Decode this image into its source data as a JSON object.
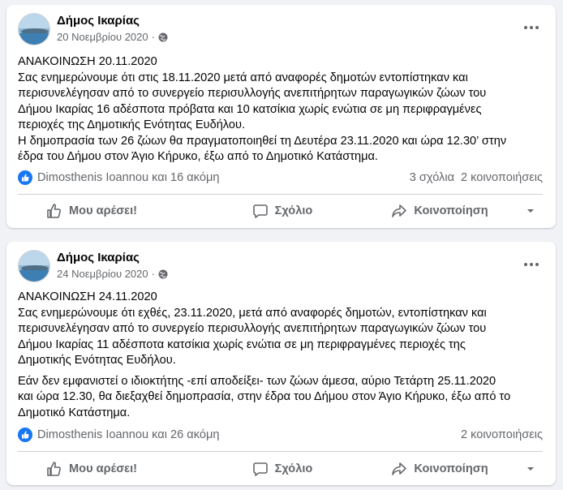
{
  "posts": [
    {
      "page_name": "Δήμος Ικαρίας",
      "date": "20 Νοεμβρίου 2020",
      "separator": "·",
      "paragraphs": [
        {
          "lines": [
            "ΑΝΑΚΟΙΝΩΣΗ 20.11.2020",
            "Σας ενημερώνουμε ότι στις 18.11.2020 μετά από αναφορές δημοτών εντοπίστηκαν και",
            "περισυνελέγησαν από το συνεργείο περισυλλογής ανεπιτήρητων παραγωγικών ζώων του",
            "Δήμου Ικαρίας 16 αδέσποτα πρόβατα και 10 κατσίκια χωρίς ενώτια σε μη περιφραγμένες",
            "περιοχές της Δημοτικής Ενότητας Ευδήλου.",
            "Η δημοπρασία των 26 ζώων θα πραγματοποιηθεί τη Δευτέρα 23.11.2020 και ώρα 12.30’ στην",
            "έδρα του Δήμου στον Άγιο Κήρυκο, έξω από το Δημοτικό Κατάστημα."
          ]
        }
      ],
      "reactions": "Dimosthenis Ioannou και 16 ακόμη",
      "comments": "3 σχόλια",
      "shares": "2 κοινοποιήσεις",
      "actions": {
        "like": "Μου αρέσει!",
        "comment": "Σχόλιο",
        "share": "Κοινοποίηση"
      }
    },
    {
      "page_name": "Δήμος Ικαρίας",
      "date": "24 Νοεμβρίου 2020",
      "separator": "·",
      "paragraphs": [
        {
          "lines": [
            "ΑΝΑΚΟΙΝΩΣΗ 24.11.2020",
            "Σας ενημερώνουμε ότι εχθές, 23.11.2020, μετά από αναφορές δημοτών, εντοπίστηκαν και",
            "περισυνελέγησαν από το συνεργείο περισυλλογής ανεπιτήρητων παραγωγικών ζώων του",
            "Δήμου Ικαρίας 11 αδέσποτα κατσίκια χωρίς ενώτια σε μη περιφραγμένες περιοχές της",
            "Δημοτικής Ενότητας Ευδήλου."
          ]
        },
        {
          "lines": [
            "Εάν δεν εμφανιστεί ο ιδιοκτήτης -επί αποδείξει- των ζώων άμεσα, αύριο Τετάρτη 25.11.2020",
            "και ώρα 12.30, θα διεξαχθεί δημοπρασία, στην έδρα του Δήμου στον Άγιο Κήρυκο, έξω από το",
            "Δημοτικό Κατάστημα."
          ]
        }
      ],
      "reactions": "Dimosthenis Ioannou και 26 ακόμη",
      "comments": "",
      "shares": "2 κοινοποιήσεις",
      "actions": {
        "like": "Μου αρέσει!",
        "comment": "Σχόλιο",
        "share": "Κοινοποίηση"
      }
    }
  ],
  "colors": {
    "background": "#f0f2f5",
    "card": "#ffffff",
    "text": "#050505",
    "secondary_text": "#65676b",
    "like_blue": "#1877f2",
    "divider": "#ced0d4"
  },
  "icons": [
    "page-avatar",
    "globe-icon",
    "more-options-icon",
    "like-reaction-icon",
    "thumbs-up-icon",
    "comment-icon",
    "share-icon",
    "caret-down-icon"
  ]
}
